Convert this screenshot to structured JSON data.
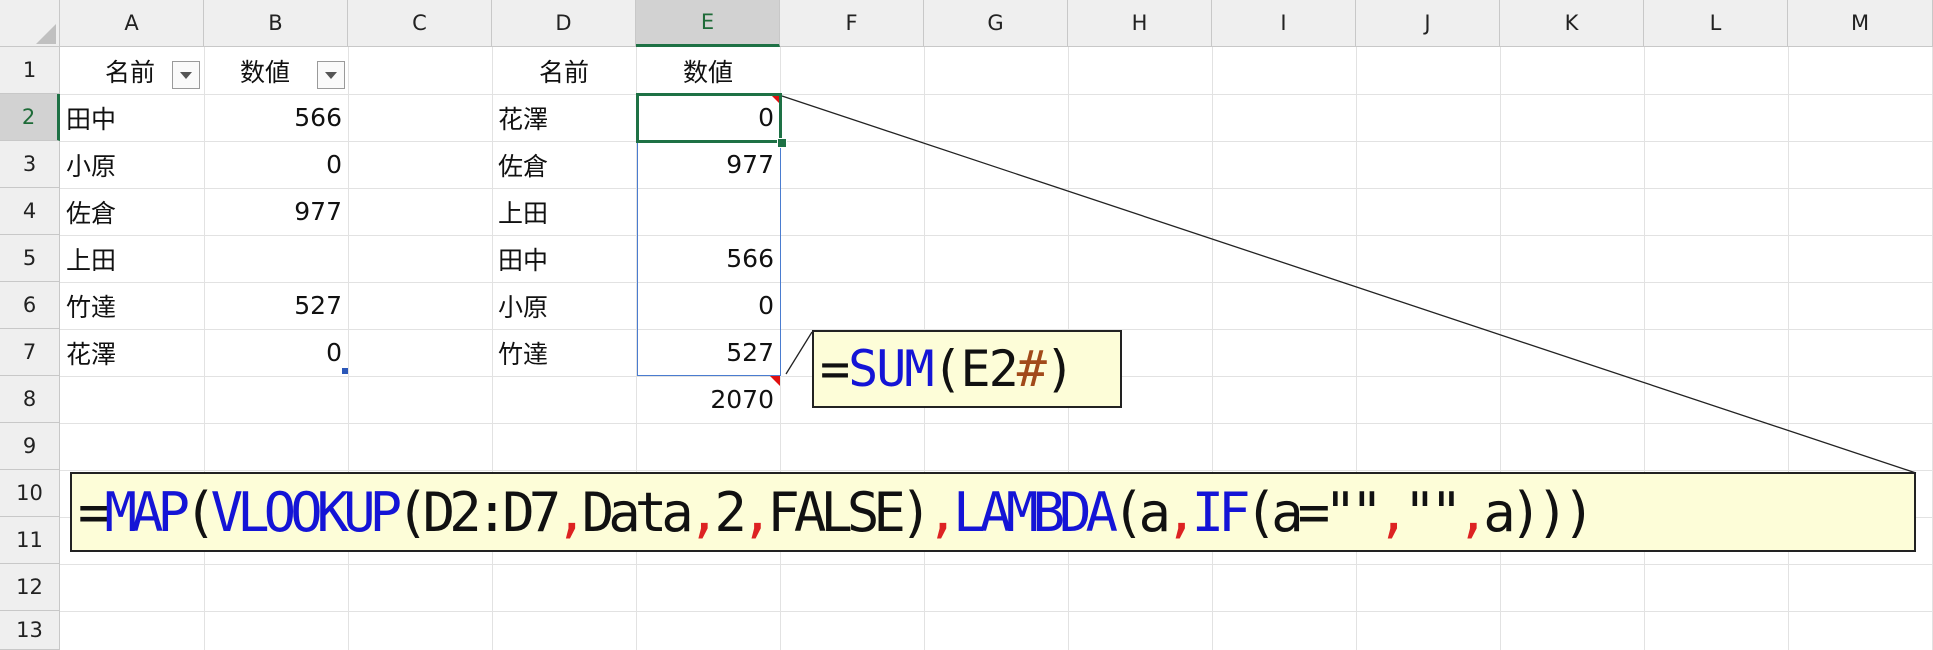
{
  "columns": [
    "A",
    "B",
    "C",
    "D",
    "E",
    "F",
    "G",
    "H",
    "I",
    "J",
    "K",
    "L",
    "M"
  ],
  "rows": [
    "1",
    "2",
    "3",
    "4",
    "5",
    "6",
    "7",
    "8",
    "9",
    "10",
    "11",
    "12",
    "13"
  ],
  "active_column": "E",
  "active_row": "2",
  "table1": {
    "header_name": "名前",
    "header_value": "数値",
    "rows": [
      {
        "name": "田中",
        "value": "566"
      },
      {
        "name": "小原",
        "value": "0"
      },
      {
        "name": "佐倉",
        "value": "977"
      },
      {
        "name": "上田",
        "value": ""
      },
      {
        "name": "竹達",
        "value": "527"
      },
      {
        "name": "花澤",
        "value": "0"
      }
    ]
  },
  "table2": {
    "header_name": "名前",
    "header_value": "数値",
    "rows": [
      {
        "name": "花澤",
        "value": "0"
      },
      {
        "name": "佐倉",
        "value": "977"
      },
      {
        "name": "上田",
        "value": ""
      },
      {
        "name": "田中",
        "value": "566"
      },
      {
        "name": "小原",
        "value": "0"
      },
      {
        "name": "竹達",
        "value": "527"
      }
    ],
    "total": "2070"
  },
  "callout_sum": {
    "t1": "=",
    "t2": "SUM",
    "t3": "(E2",
    "t4": "#",
    "t5": ")"
  },
  "callout_map": {
    "t1": "=",
    "t2": "MAP",
    "t3": "(",
    "t4": "VLOOKUP",
    "t5": "(D2:D7",
    "t6": ",",
    "t7": "Data",
    "t8": ",",
    "t9": "2",
    "t10": ",",
    "t11": "FALSE)",
    "t12": ",",
    "t13": "LAMBDA",
    "t14": "(a",
    "t15": ",",
    "t16": "IF",
    "t17": "(a=\"\"",
    "t18": ",",
    "t19": "\"\"",
    "t20": ",",
    "t21": "a)))"
  },
  "colors": {
    "function": "#1414d6",
    "separator": "#d22222",
    "spill": "#a14a1a",
    "callout_bg": "#fdfdd8",
    "selection": "#1e7145",
    "spill_border": "#4a7cd0",
    "comment_marker": "#e01010"
  }
}
